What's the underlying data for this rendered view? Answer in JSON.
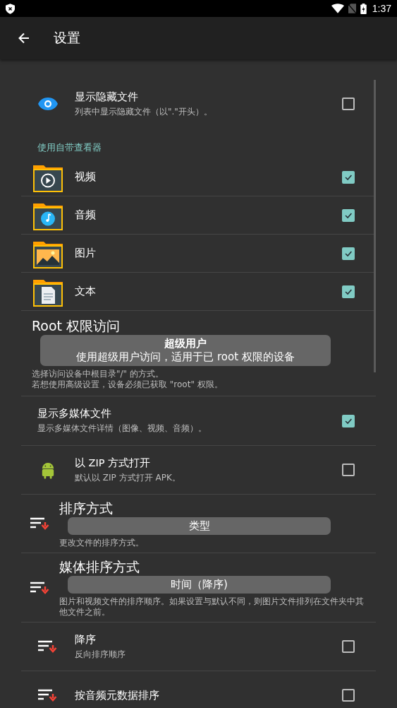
{
  "status_bar": {
    "time": "1:37"
  },
  "app_bar": {
    "title": "设置"
  },
  "settings": [
    {
      "kind": "toggle",
      "title": "显示隐藏文件",
      "subtitle": "列表中显示隐藏文件（以\".\"开头）。",
      "checked": false
    },
    {
      "kind": "header",
      "title": "使用自带查看器"
    },
    {
      "kind": "toggle",
      "title": "视频",
      "checked": true
    },
    {
      "kind": "toggle",
      "title": "音频",
      "checked": true
    },
    {
      "kind": "toggle",
      "title": "图片",
      "checked": true
    },
    {
      "kind": "toggle",
      "title": "文本",
      "checked": true
    },
    {
      "kind": "select",
      "title": "Root 权限访问",
      "value": "超级用户",
      "value_detail": "使用超级用户访问，适用于已 root 权限的设备",
      "description": [
        "选择访问设备中根目录\"/\" 的方式。",
        "若想使用高级设置，设备必须已获取 \"root\" 权限。"
      ]
    },
    {
      "kind": "toggle",
      "title": "显示多媒体文件",
      "subtitle": "显示多媒体文件详情（图像、视频、音频）。",
      "checked": true
    },
    {
      "kind": "toggle",
      "title": "以 ZIP 方式打开",
      "subtitle": "默认以 ZIP 方式打开 APK。",
      "checked": false
    },
    {
      "kind": "select",
      "title": "排序方式",
      "value": "类型",
      "description": [
        "更改文件的排序方式。"
      ]
    },
    {
      "kind": "select",
      "title": "媒体排序方式",
      "value": "时间（降序)",
      "description": [
        "图片和视频文件的排序顺序。如果设置与默认不同，则图片文件排列在文件夹中其他文件之前。"
      ]
    },
    {
      "kind": "toggle",
      "title": "降序",
      "subtitle": "反向排序顺序",
      "checked": false
    },
    {
      "kind": "toggle",
      "title": "按音频元数据排序",
      "checked": false
    }
  ]
}
